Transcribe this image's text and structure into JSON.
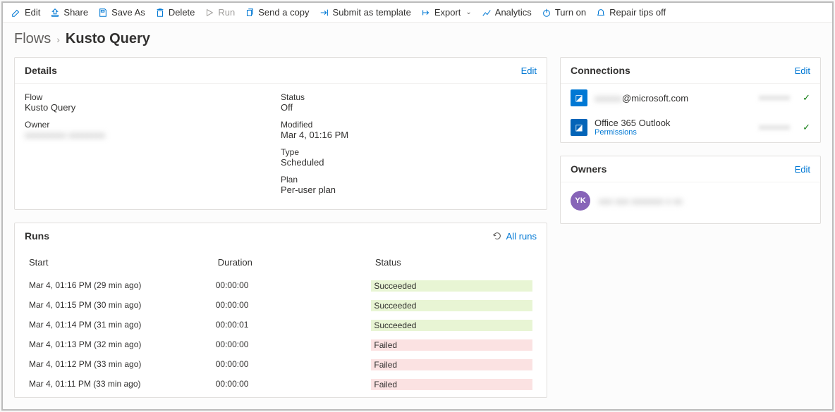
{
  "toolbar": {
    "edit": "Edit",
    "share": "Share",
    "save_as": "Save As",
    "delete": "Delete",
    "run": "Run",
    "send_copy": "Send a copy",
    "submit_template": "Submit as template",
    "export": "Export",
    "analytics": "Analytics",
    "turn_on": "Turn on",
    "repair_tips": "Repair tips off"
  },
  "breadcrumb": {
    "root": "Flows",
    "current": "Kusto Query"
  },
  "details": {
    "title": "Details",
    "edit_link": "Edit",
    "flow_label": "Flow",
    "flow_value": "Kusto Query",
    "owner_label": "Owner",
    "owner_value": "xxxxxxxxx xxxxxxxx",
    "status_label": "Status",
    "status_value": "Off",
    "modified_label": "Modified",
    "modified_value": "Mar 4, 01:16 PM",
    "type_label": "Type",
    "type_value": "Scheduled",
    "plan_label": "Plan",
    "plan_value": "Per-user plan"
  },
  "connections": {
    "title": "Connections",
    "edit_link": "Edit",
    "items": [
      {
        "name": "@microsoft.com",
        "name_prefix_hidden": "xxxxxx",
        "icon_color": "#0078d4",
        "sub": "",
        "right_hidden": "xxxxxxxx"
      },
      {
        "name": "Office 365 Outlook",
        "icon_color": "#0364b8",
        "sub": "Permissions",
        "right_hidden": "xxxxxxxx"
      }
    ]
  },
  "owners": {
    "title": "Owners",
    "edit_link": "Edit",
    "avatar_initials": "YK",
    "name_hidden": "xxx xxx xxxxxxx x xx"
  },
  "runs": {
    "title": "Runs",
    "all_runs": "All runs",
    "columns": {
      "start": "Start",
      "duration": "Duration",
      "status": "Status"
    },
    "rows": [
      {
        "start": "Mar 4, 01:16 PM (29 min ago)",
        "duration": "00:00:00",
        "status": "Succeeded"
      },
      {
        "start": "Mar 4, 01:15 PM (30 min ago)",
        "duration": "00:00:00",
        "status": "Succeeded"
      },
      {
        "start": "Mar 4, 01:14 PM (31 min ago)",
        "duration": "00:00:01",
        "status": "Succeeded"
      },
      {
        "start": "Mar 4, 01:13 PM (32 min ago)",
        "duration": "00:00:00",
        "status": "Failed"
      },
      {
        "start": "Mar 4, 01:12 PM (33 min ago)",
        "duration": "00:00:00",
        "status": "Failed"
      },
      {
        "start": "Mar 4, 01:11 PM (33 min ago)",
        "duration": "00:00:00",
        "status": "Failed"
      }
    ]
  }
}
